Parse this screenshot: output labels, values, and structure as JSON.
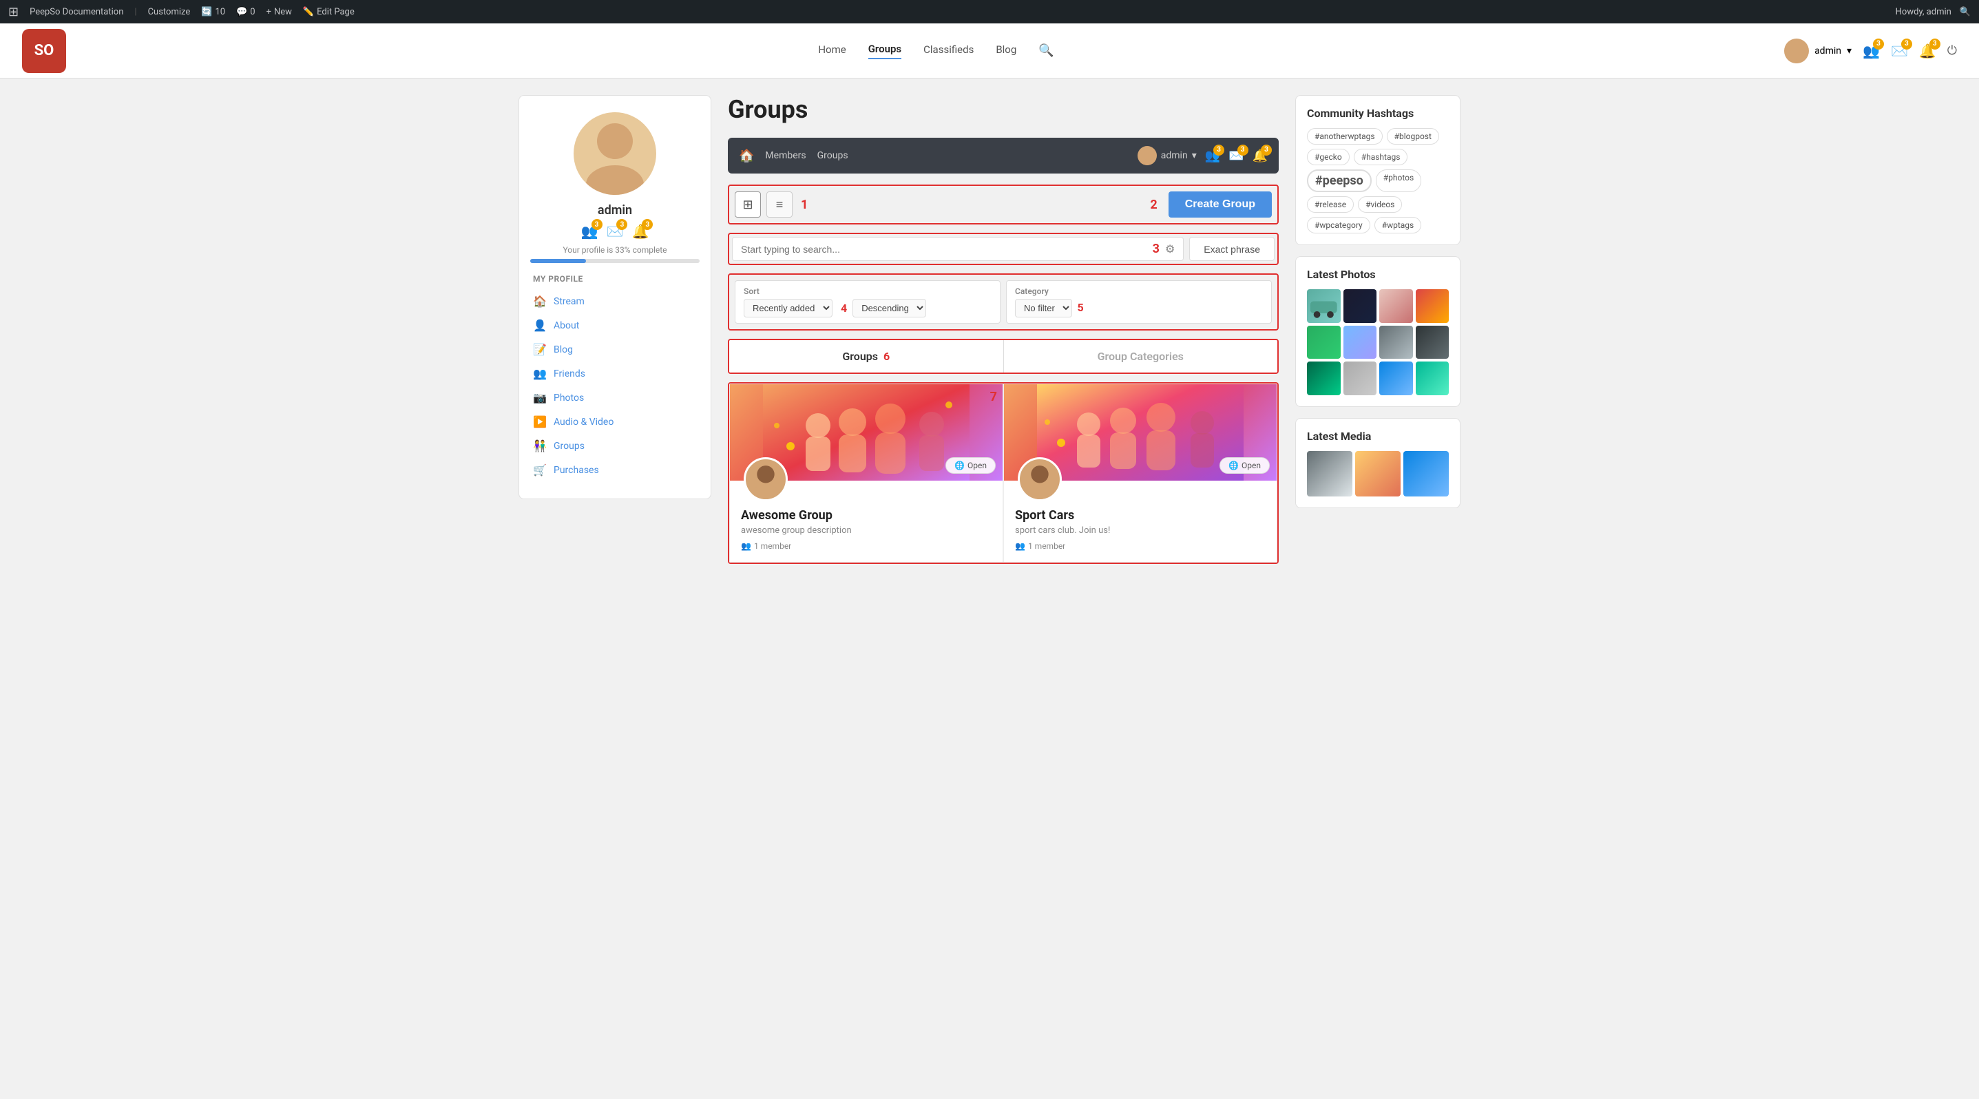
{
  "adminBar": {
    "wpLabel": "⊞",
    "siteName": "PeepSo Documentation",
    "customize": "Customize",
    "updates": "10",
    "comments": "0",
    "new": "New",
    "editPage": "Edit Page",
    "howdy": "Howdy, admin",
    "searchIcon": "🔍"
  },
  "siteHeader": {
    "logoText": "SO",
    "navItems": [
      {
        "label": "Home",
        "active": false
      },
      {
        "label": "Groups",
        "active": true
      },
      {
        "label": "Classifieds",
        "active": false
      },
      {
        "label": "Blog",
        "active": false
      }
    ],
    "user": "admin",
    "badges": {
      "friends": "3",
      "messages": "3",
      "notifications": "3"
    }
  },
  "secNav": {
    "members": "Members",
    "groups": "Groups",
    "adminUser": "admin",
    "badges": {
      "friends": "3",
      "messages": "3",
      "notifications": "3"
    }
  },
  "sidebar": {
    "profileName": "admin",
    "profileComplete": "Your profile is 33% complete",
    "profileProgress": 33,
    "badges": {
      "friends": "3",
      "messages": "3",
      "notifications": "3"
    },
    "myProfileLabel": "MY PROFILE",
    "menuItems": [
      {
        "icon": "🏠",
        "label": "Stream"
      },
      {
        "icon": "👤",
        "label": "About"
      },
      {
        "icon": "📝",
        "label": "Blog"
      },
      {
        "icon": "👥",
        "label": "Friends"
      },
      {
        "icon": "📷",
        "label": "Photos"
      },
      {
        "icon": "▶️",
        "label": "Audio & Video"
      },
      {
        "icon": "👫",
        "label": "Groups"
      },
      {
        "icon": "🛒",
        "label": "Purchases"
      }
    ]
  },
  "groupsPage": {
    "title": "Groups",
    "toolbar": {
      "annotation1": "1",
      "annotation2": "2",
      "createGroup": "Create Group"
    },
    "search": {
      "placeholder": "Start typing to search...",
      "annotation3": "3",
      "exactPhrase": "Exact phrase"
    },
    "sort": {
      "label": "Sort",
      "annotation4": "4",
      "value": "Recently added",
      "order": "Descending"
    },
    "category": {
      "label": "Category",
      "annotation5": "5",
      "value": "No filter"
    },
    "tabs": {
      "groups": "Groups",
      "groupCategories": "Group Categories",
      "annotation6": "6"
    },
    "annotation7": "7",
    "groups": [
      {
        "name": "Awesome Group",
        "description": "awesome group description",
        "members": "1 member",
        "type": "Open"
      },
      {
        "name": "Sport Cars",
        "description": "sport cars club. Join us!",
        "members": "1 member",
        "type": "Open"
      }
    ]
  },
  "rightSidebar": {
    "hashtagsTitle": "Community Hashtags",
    "hashtags": [
      {
        "label": "#anotherwptags",
        "large": false
      },
      {
        "label": "#blogpost",
        "large": false
      },
      {
        "label": "#gecko",
        "large": false
      },
      {
        "label": "#hashtags",
        "large": false
      },
      {
        "label": "#peepso",
        "large": true
      },
      {
        "label": "#photos",
        "large": false
      },
      {
        "label": "#release",
        "large": false
      },
      {
        "label": "#videos",
        "large": false
      },
      {
        "label": "#wpcategory",
        "large": false
      },
      {
        "label": "#wptags",
        "large": false
      }
    ],
    "latestPhotosTitle": "Latest Photos",
    "photos": [
      "car",
      "dark-car",
      "woman",
      "flowers",
      "nature",
      "girl",
      "laptop",
      "storm",
      "forest",
      "bird",
      "ocean",
      "island"
    ],
    "latestMediaTitle": "Latest Media"
  }
}
